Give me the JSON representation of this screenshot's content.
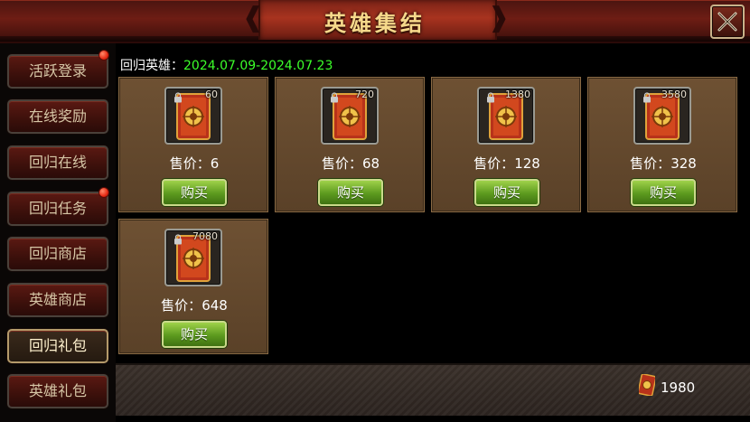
{
  "header": {
    "title": "英雄集结"
  },
  "icons": {
    "close": "close-x-icon",
    "scroll": "scroll-icon",
    "lock": "lock-icon",
    "badge": "red-dot-badge-icon"
  },
  "colors": {
    "date_green": "#3cff2a",
    "buy_green": "#5c9a1e",
    "badge_red": "#e62a14",
    "card_brown": "#6e5133"
  },
  "sidebar": {
    "items": [
      {
        "label": "活跃登录",
        "badge": true,
        "active": false
      },
      {
        "label": "在线奖励",
        "badge": false,
        "active": false
      },
      {
        "label": "回归在线",
        "badge": false,
        "active": false
      },
      {
        "label": "回归任务",
        "badge": true,
        "active": false
      },
      {
        "label": "回归商店",
        "badge": false,
        "active": false
      },
      {
        "label": "英雄商店",
        "badge": false,
        "active": false
      },
      {
        "label": "回归礼包",
        "badge": false,
        "active": true
      },
      {
        "label": "英雄礼包",
        "badge": false,
        "active": false
      }
    ]
  },
  "main": {
    "subtitle_label": "回归英雄：",
    "subtitle_date": "2024.07.09-2024.07.23",
    "price_prefix": "售价：",
    "buy_label": "购买",
    "items": [
      {
        "qty": "60",
        "price": "6"
      },
      {
        "qty": "720",
        "price": "68"
      },
      {
        "qty": "1380",
        "price": "128"
      },
      {
        "qty": "3580",
        "price": "328"
      },
      {
        "qty": "7080",
        "price": "648"
      }
    ]
  },
  "footer": {
    "balance": "1980"
  }
}
